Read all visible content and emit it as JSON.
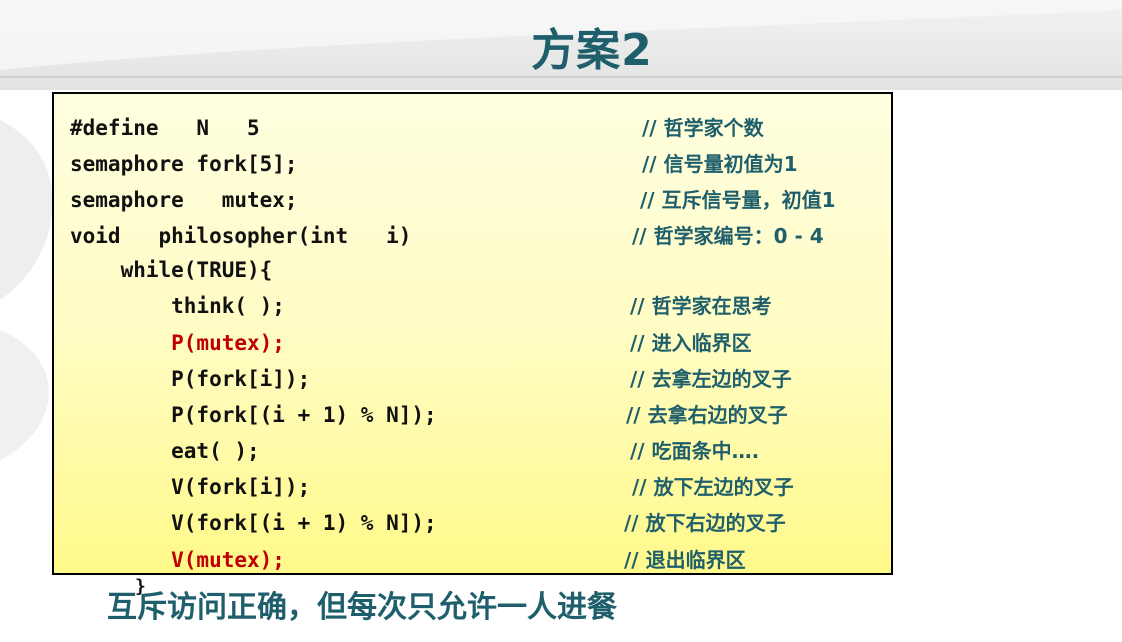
{
  "title": "方案2",
  "code_lines": [
    {
      "code": "#define   N   5",
      "comment": "// 哲学家个数",
      "red": false
    },
    {
      "code": "semaphore fork[5];",
      "comment": "// 信号量初值为1",
      "red": false
    },
    {
      "code": "semaphore   mutex;",
      "comment": "// 互斥信号量，初值1",
      "red": false
    },
    {
      "code": "void   philosopher(int   i)",
      "comment": "// 哲学家编号：0 - 4",
      "red": false
    },
    {
      "code": "    while(TRUE){",
      "comment": "",
      "red": false
    },
    {
      "code": "        think( );",
      "comment": "// 哲学家在思考",
      "red": false
    },
    {
      "code": "        P(mutex);",
      "comment": "// 进入临界区",
      "red": true
    },
    {
      "code": "        P(fork[i]);",
      "comment": "// 去拿左边的叉子",
      "red": false
    },
    {
      "code": "        P(fork[(i + 1) % N]);",
      "comment": "// 去拿右边的叉子",
      "red": false
    },
    {
      "code": "        eat( );",
      "comment": "// 吃面条中….",
      "red": false
    },
    {
      "code": "        V(fork[i]);",
      "comment": "// 放下左边的叉子",
      "red": false
    },
    {
      "code": "        V(fork[(i + 1) % N]);",
      "comment": "// 放下右边的叉子",
      "red": false
    },
    {
      "code": "        V(mutex);",
      "comment": "// 退出临界区",
      "red": true
    }
  ],
  "closing_brace": "}",
  "footer": "互斥访问正确，但每次只允许一人进餐",
  "colors": {
    "title": "#1f5f6b",
    "comment": "#1f5f6b",
    "highlight_code": "#c00000",
    "box_border": "#000000"
  }
}
